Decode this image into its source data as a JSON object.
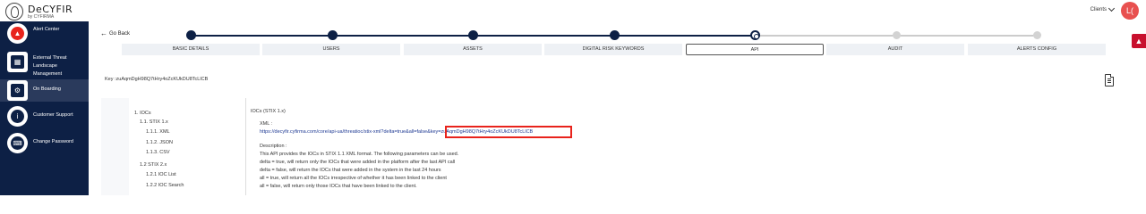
{
  "brand": {
    "name": "DeCYFIR",
    "tagline": "by CYFIRMA"
  },
  "header": {
    "clients_label": "Clients",
    "avatar_initials": "L("
  },
  "sidebar": {
    "items": [
      {
        "label": "Alert Center",
        "icon": "alarm-bell-icon"
      },
      {
        "label": "External Threat Landscape Management",
        "icon": "threat-landscape-icon"
      },
      {
        "label": "On Boarding",
        "icon": "onboarding-icon",
        "active": true
      },
      {
        "label": "Customer Support",
        "icon": "info-icon"
      },
      {
        "label": "Change Password",
        "icon": "keyboard-icon"
      }
    ]
  },
  "nav": {
    "go_back": "Go Back"
  },
  "steps": [
    {
      "label": "BASIC DETAILS",
      "state": "done"
    },
    {
      "label": "USERS",
      "state": "done"
    },
    {
      "label": "ASSETS",
      "state": "done"
    },
    {
      "label": "DIGITAL RISK KEYWORDS",
      "state": "done"
    },
    {
      "label": "API",
      "state": "current"
    },
    {
      "label": "AUDIT",
      "state": "todo"
    },
    {
      "label": "ALERTS CONFIG",
      "state": "todo"
    }
  ],
  "api": {
    "key_line": "Key :zuAqmDgH98Q7tHry4oZcKUkDU8TcLlCB",
    "tree": {
      "root": "1. IOCs",
      "stix1": "1.1. STIX 1.x",
      "xml": "1.1.1. XML",
      "json": "1.1.2. JSON",
      "csv": "1.1.3. CSV",
      "stix2": "1.2 STIX 2.x",
      "ioc_list": "1.2.1 IOC List",
      "ioc_search": "1.2.2 IOC Search"
    },
    "section_title": "IOCs (STIX 1.x)",
    "xml_label": "XML :",
    "url_base": "https://decyfir.cyfirma.com/core/api-ua/threatioc/stix-xml?delta=true&all=false&",
    "url_key": "key=zuAqmDgH98Q7tHry4oZcKUkDU8TcLlCB",
    "description_label": "Description :",
    "description_lines": [
      "This API provides the IOCs in STIX 1.1 XML format. The following parameters can be used.",
      "delta = true, will return only the IOCs that were added in the platform after the last API call",
      "delta = false, will return the IOCs that were added in the system in the last 24 hours",
      "all = true, will return all the IOCs irrespective of whether it has been linked to the client",
      "all = false, will return only those IOCs that have been linked to the client."
    ]
  },
  "colors": {
    "sidebar": "#0d2045",
    "accent": "#e8504f",
    "highlight": "#e8231c"
  }
}
